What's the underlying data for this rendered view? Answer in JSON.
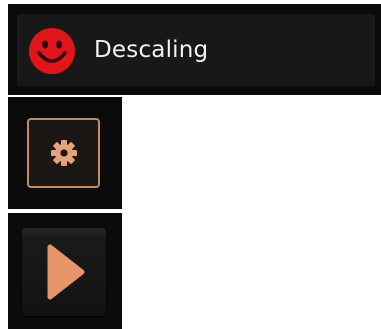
{
  "status_banner": {
    "icon": "red-smiley-face-icon",
    "label": "Descaling",
    "colors": {
      "background": "#181818",
      "icon": "#e0161b",
      "text": "#f2f2f2"
    }
  },
  "settings_button": {
    "icon": "gear-icon",
    "colors": {
      "border": "#c38b6a",
      "icon": "#e8a27a"
    }
  },
  "play_button": {
    "icon": "play-icon",
    "colors": {
      "icon": "#e8946a"
    }
  }
}
